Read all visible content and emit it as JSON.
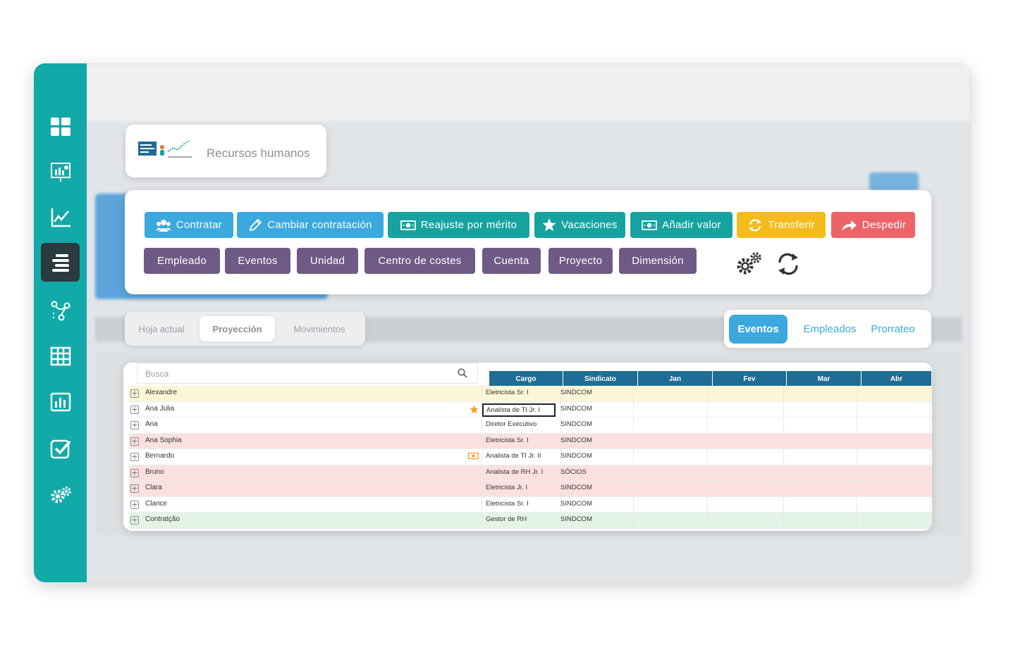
{
  "sidebar": {
    "items": [
      {
        "icon": "dashboard-icon"
      },
      {
        "icon": "presentation-chart-icon"
      },
      {
        "icon": "line-chart-icon"
      },
      {
        "icon": "hr-list-icon",
        "active": true
      },
      {
        "icon": "flow-icon"
      },
      {
        "icon": "table-icon"
      },
      {
        "icon": "bar-report-icon"
      },
      {
        "icon": "checklist-icon"
      },
      {
        "icon": "settings-gears-icon"
      }
    ]
  },
  "header": {
    "title": "Recursos humanos"
  },
  "actions": {
    "primary": [
      {
        "label": "Contratar",
        "color": "#3ba8de",
        "icon": "users-icon"
      },
      {
        "label": "Cambiar contratación",
        "color": "#3ba8de",
        "icon": "pencil-icon"
      },
      {
        "label": "Reajuste por mérito",
        "color": "#16a3a0",
        "icon": "money-icon"
      },
      {
        "label": "Vacaciones",
        "color": "#16a3a0",
        "icon": "star-icon"
      },
      {
        "label": "Añadir valor",
        "color": "#16a3a0",
        "icon": "money-icon"
      },
      {
        "label": "Transferir",
        "color": "#f4bb1c",
        "icon": "transfer-icon"
      },
      {
        "label": "Despedir",
        "color": "#ec6468",
        "icon": "share-arrow-icon"
      }
    ],
    "secondary": [
      {
        "label": "Empleado"
      },
      {
        "label": "Eventos"
      },
      {
        "label": "Unidad"
      },
      {
        "label": "Centro de costes"
      },
      {
        "label": "Cuenta"
      },
      {
        "label": "Proyecto"
      },
      {
        "label": "Dimensión"
      }
    ],
    "secondary_color": "#6f5a86"
  },
  "view_tabs": {
    "items": [
      "Hoja actual",
      "Proyección",
      "Movimientos"
    ],
    "active": "Proyección"
  },
  "right_tabs": {
    "items": [
      "Eventos",
      "Empleados",
      "Prorrateo"
    ],
    "active": "Eventos"
  },
  "grid": {
    "search_placeholder": "Busca",
    "columns": [
      "Cargo",
      "Sindicato",
      "Jan",
      "Fev",
      "Mar",
      "Abr"
    ],
    "rows": [
      {
        "name": "Alexandre",
        "cargo": "Eletricista Sr. I",
        "sindicato": "SINDCOM",
        "color": "yellow"
      },
      {
        "name": "Ana Julia",
        "cargo": "Analista de TI Jr. I",
        "sindicato": "SINDCOM",
        "color": "white",
        "icon": "star-icon",
        "selected": true
      },
      {
        "name": "Ana",
        "cargo": "Diretor Executivo",
        "sindicato": "SINDCOM",
        "color": "white"
      },
      {
        "name": "Ana Sophia",
        "cargo": "Eletricista Sr. I",
        "sindicato": "SINDCOM",
        "color": "pink"
      },
      {
        "name": "Bernardo",
        "cargo": "Analista de TI Jr. II",
        "sindicato": "SINDCOM",
        "color": "white",
        "icon": "money-icon"
      },
      {
        "name": "Bruno",
        "cargo": "Analista de RH Jr. I",
        "sindicato": "SÓCIOS",
        "color": "pink"
      },
      {
        "name": "Clara",
        "cargo": "Eletricista Jr. I",
        "sindicato": "SINDCOM",
        "color": "pink"
      },
      {
        "name": "Clarice",
        "cargo": "Eletricista Sr. I",
        "sindicato": "SINDCOM",
        "color": "white"
      },
      {
        "name": "Contratção",
        "cargo": "Gestor de RH",
        "sindicato": "SINDCOM",
        "color": "green"
      }
    ]
  }
}
